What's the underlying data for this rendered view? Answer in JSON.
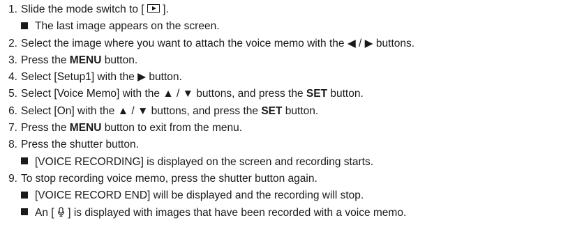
{
  "steps": [
    {
      "num": "1.",
      "pre": "Slide the mode switch to [",
      "post": "].",
      "notes": [
        "The last image appears on the screen."
      ]
    },
    {
      "num": "2.",
      "text": "Select the image where you want to attach the voice memo with the ◀ / ▶ buttons."
    },
    {
      "num": "3.",
      "pre": "Press the ",
      "bold": "MENU",
      "post": " button."
    },
    {
      "num": "4.",
      "text": "Select [Setup1] with the ▶ button."
    },
    {
      "num": "5.",
      "pre": "Select [Voice Memo] with the ▲ / ▼ buttons, and press the ",
      "bold": "SET",
      "post": " button."
    },
    {
      "num": "6.",
      "pre": "Select [On] with the ▲ / ▼ buttons, and press the ",
      "bold": "SET",
      "post": " button."
    },
    {
      "num": "7.",
      "pre": "Press the ",
      "bold": "MENU",
      "post": " button to exit from the menu."
    },
    {
      "num": "8.",
      "text": "Press the shutter button.",
      "notes": [
        "[VOICE RECORDING] is displayed on the screen and recording starts."
      ]
    },
    {
      "num": "9.",
      "text": "To stop recording voice memo, press the shutter button again.",
      "notes": [
        "[VOICE RECORD END] will be displayed and the recording will stop."
      ],
      "note_icon": {
        "pre": "An [",
        "post": "] is displayed with images that have been recorded with a voice memo."
      }
    }
  ],
  "icons": {
    "playback_mode": "playback-mode-icon",
    "voice_memo": "voice-memo-icon"
  }
}
